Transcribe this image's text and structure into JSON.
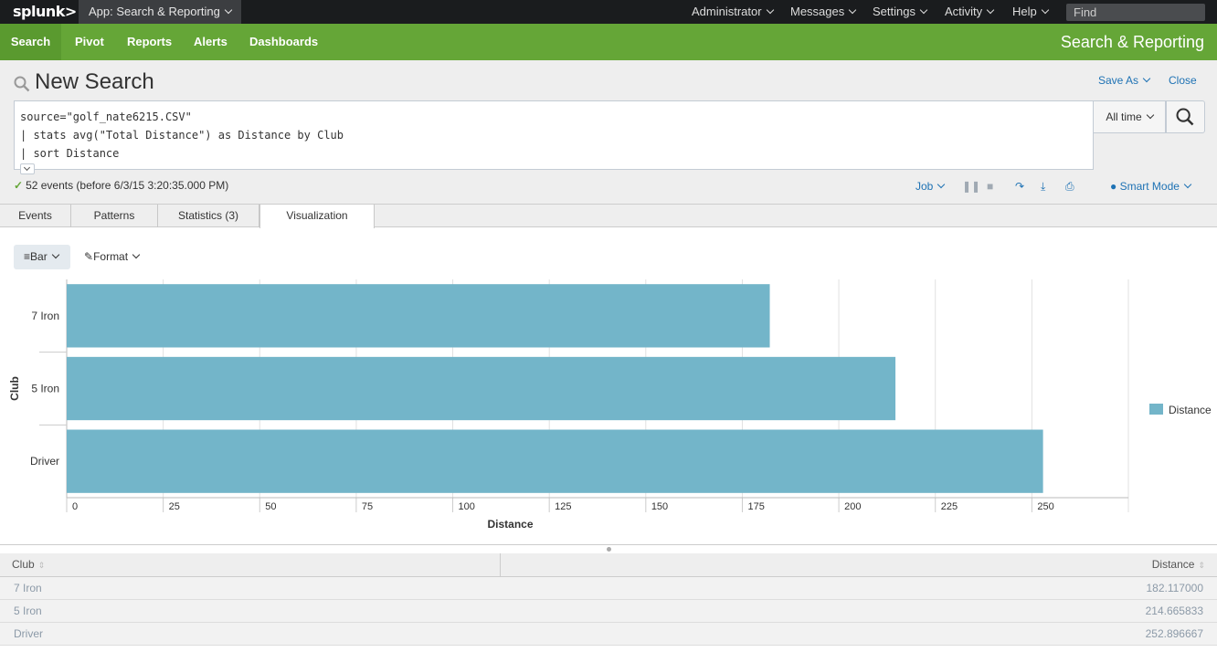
{
  "topbar": {
    "logo": "splunk>",
    "app_menu": "App: Search & Reporting",
    "menus": [
      "Administrator",
      "Messages",
      "Settings",
      "Activity",
      "Help"
    ],
    "find_placeholder": "Find"
  },
  "appnav": {
    "items": [
      "Search",
      "Pivot",
      "Reports",
      "Alerts",
      "Dashboards"
    ],
    "app_title": "Search & Reporting"
  },
  "search": {
    "page_title": "New Search",
    "save_as": "Save As",
    "close": "Close",
    "query_lines": [
      "source=\"golf_nate6215.CSV\"",
      "| stats avg(\"Total Distance\") as Distance by Club",
      "| sort Distance"
    ],
    "time_range": "All time",
    "status": "52 events (before 6/3/15 3:20:35.000 PM)",
    "job": "Job",
    "smart_mode": "Smart Mode"
  },
  "tabs": [
    "Events",
    "Patterns",
    "Statistics (3)",
    "Visualization"
  ],
  "viz_controls": {
    "type": "Bar",
    "format": "Format"
  },
  "colors": {
    "nav_green": "#65a637",
    "bar_color": "#73b5c9",
    "link_blue": "#1e72b4"
  },
  "chart_data": {
    "type": "bar",
    "orientation": "horizontal",
    "categories": [
      "7 Iron",
      "5 Iron",
      "Driver"
    ],
    "series": [
      {
        "name": "Distance",
        "values": [
          182.117,
          214.665833,
          252.896667
        ]
      }
    ],
    "xlabel": "Distance",
    "ylabel": "Club",
    "xlim": [
      0,
      275
    ],
    "xticks": [
      0,
      25,
      50,
      75,
      100,
      125,
      150,
      175,
      200,
      225,
      250
    ],
    "grid": true,
    "legend": "right"
  },
  "table": {
    "headers": [
      "Club",
      "Distance"
    ],
    "rows": [
      [
        "7 Iron",
        "182.117000"
      ],
      [
        "5 Iron",
        "214.665833"
      ],
      [
        "Driver",
        "252.896667"
      ]
    ]
  }
}
